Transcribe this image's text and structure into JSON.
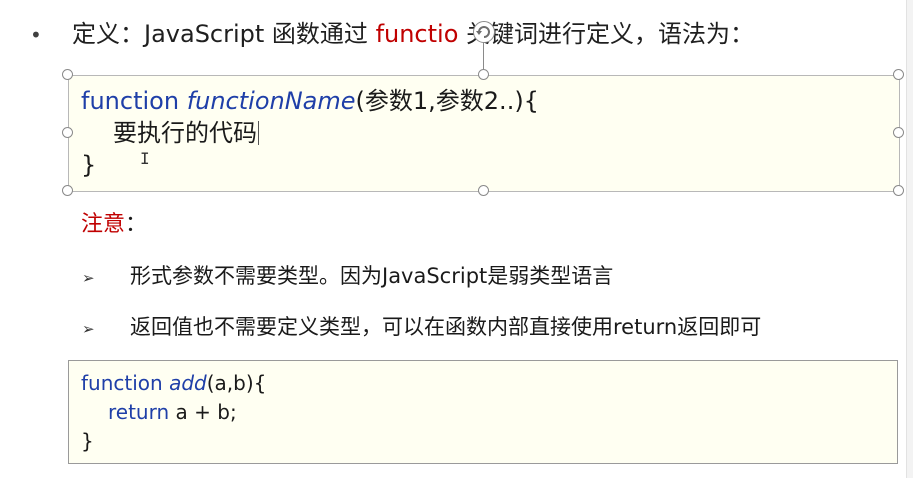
{
  "heading": {
    "bullet": "•",
    "prefix": "定义：JavaScript 函数通过 ",
    "keyword": "functio",
    "suffix": " 关键词进行定义，语法为："
  },
  "syntax_box": {
    "line1_keyword": "function",
    "line1_name": "functionName",
    "line1_params": "(参数1,参数2..){",
    "line2_body": "要执行的代码",
    "line3_close": "}"
  },
  "note": {
    "label": "注意",
    "colon": "："
  },
  "points": [
    {
      "marker": "➢",
      "text": "形式参数不需要类型。因为JavaScript是弱类型语言"
    },
    {
      "marker": "➢",
      "text": "返回值也不需要定义类型，可以在函数内部直接使用return返回即可"
    }
  ],
  "example_box": {
    "line1_keyword": "function",
    "line1_name": "add",
    "line1_params": "(a,b){",
    "line2_keyword": "return",
    "line2_expr": " a + b;",
    "line3_close": "}"
  },
  "colors": {
    "keyword_blue": "#1f3fa8",
    "accent_red": "#c00000",
    "box_fill": "#fffff2"
  },
  "icons": {
    "rotate": "rotate-handle-icon",
    "cursor": "text-cursor-icon"
  }
}
